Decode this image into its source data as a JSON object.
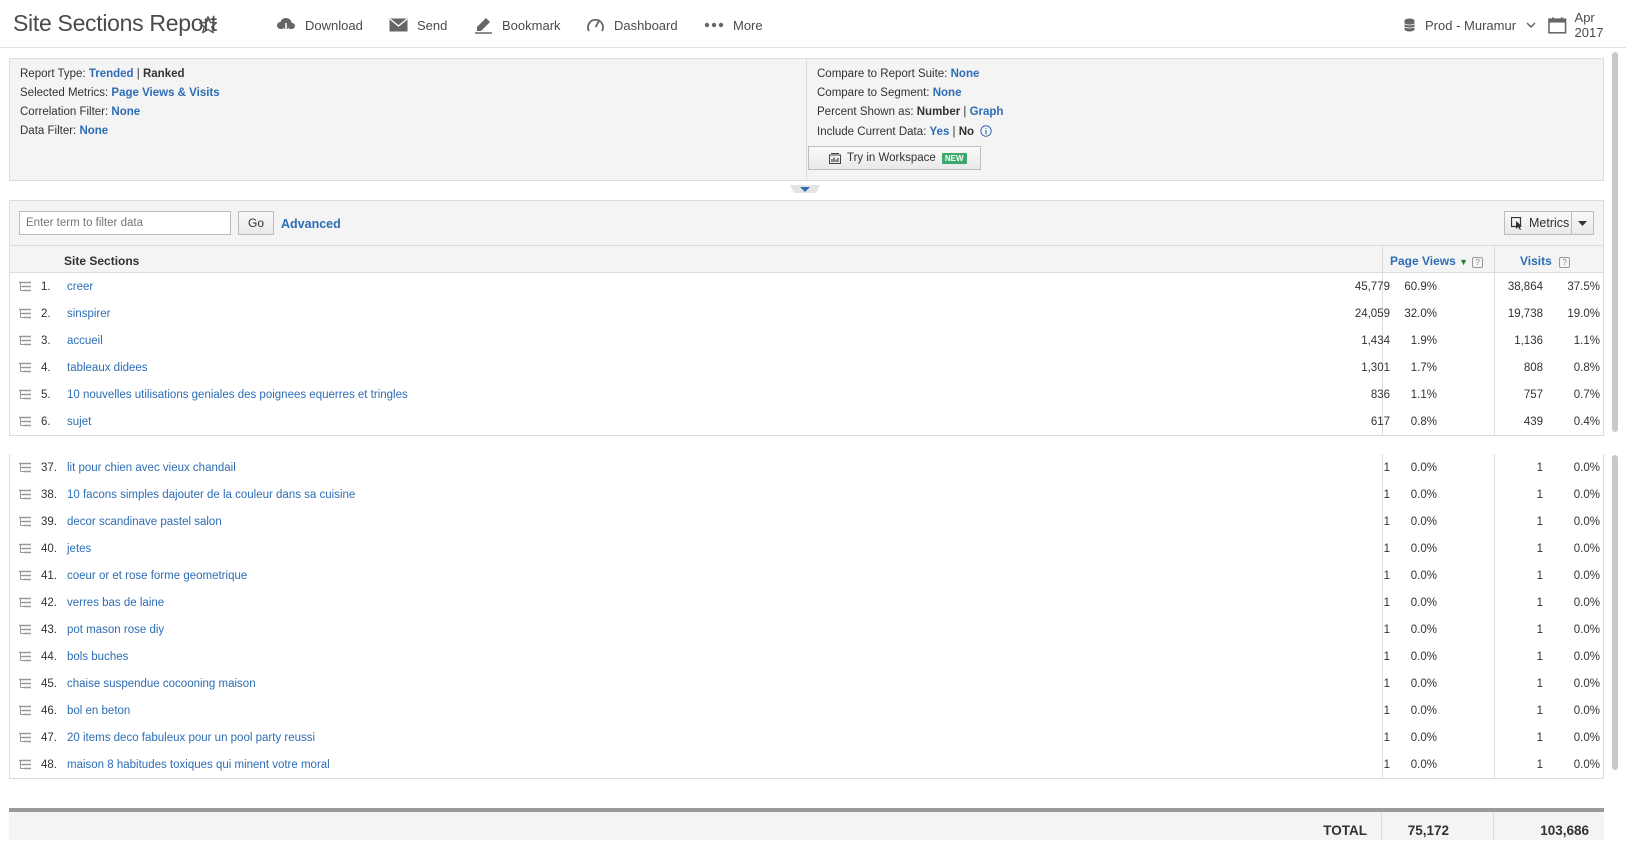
{
  "header": {
    "title": "Site Sections Report",
    "toolbar": [
      {
        "label": "Download",
        "icon": "download-icon"
      },
      {
        "label": "Send",
        "icon": "send-icon"
      },
      {
        "label": "Bookmark",
        "icon": "bookmark-icon"
      },
      {
        "label": "Dashboard",
        "icon": "dashboard-icon"
      },
      {
        "label": "More",
        "icon": "more-icon"
      }
    ],
    "report_suite": "Prod - Muramur",
    "date": "Apr 2017"
  },
  "settings": {
    "report_type_label": "Report Type:",
    "report_type_trended": "Trended",
    "report_type_ranked": "Ranked",
    "metrics_label": "Selected Metrics:",
    "metrics_value": "Page Views & Visits",
    "correlation_label": "Correlation Filter:",
    "correlation_value": "None",
    "data_filter_label": "Data Filter:",
    "data_filter_value": "None",
    "compare_suite_label": "Compare to Report Suite:",
    "compare_suite_value": "None",
    "compare_segment_label": "Compare to Segment:",
    "compare_segment_value": "None",
    "percent_label": "Percent Shown as:",
    "percent_number": "Number",
    "percent_graph": "Graph",
    "current_data_label": "Include Current Data:",
    "current_data_yes": "Yes",
    "current_data_no": "No",
    "workspace_button": "Try in Workspace",
    "new_badge": "NEW"
  },
  "filter": {
    "placeholder": "Enter term to filter data",
    "go_label": "Go",
    "advanced_label": "Advanced",
    "metrics_label": "Metrics"
  },
  "table": {
    "col_name": "Site Sections",
    "col_page_views": "Page Views",
    "col_visits": "Visits",
    "rows_top": [
      {
        "rank": "1.",
        "name": "creer",
        "pv": "45,779",
        "pvp": "60.9%",
        "vi": "38,864",
        "vip": "37.5%"
      },
      {
        "rank": "2.",
        "name": "sinspirer",
        "pv": "24,059",
        "pvp": "32.0%",
        "vi": "19,738",
        "vip": "19.0%"
      },
      {
        "rank": "3.",
        "name": "accueil",
        "pv": "1,434",
        "pvp": "1.9%",
        "vi": "1,136",
        "vip": "1.1%"
      },
      {
        "rank": "4.",
        "name": "tableaux didees",
        "pv": "1,301",
        "pvp": "1.7%",
        "vi": "808",
        "vip": "0.8%"
      },
      {
        "rank": "5.",
        "name": "10 nouvelles utilisations geniales des poignees equerres et tringles",
        "pv": "836",
        "pvp": "1.1%",
        "vi": "757",
        "vip": "0.7%"
      },
      {
        "rank": "6.",
        "name": "sujet",
        "pv": "617",
        "pvp": "0.8%",
        "vi": "439",
        "vip": "0.4%"
      }
    ],
    "rows_bottom": [
      {
        "rank": "37.",
        "name": "lit pour chien avec vieux chandail",
        "pv": "1",
        "pvp": "0.0%",
        "vi": "1",
        "vip": "0.0%"
      },
      {
        "rank": "38.",
        "name": "10 facons simples dajouter de la couleur dans sa cuisine",
        "pv": "1",
        "pvp": "0.0%",
        "vi": "1",
        "vip": "0.0%"
      },
      {
        "rank": "39.",
        "name": "decor scandinave pastel salon",
        "pv": "1",
        "pvp": "0.0%",
        "vi": "1",
        "vip": "0.0%"
      },
      {
        "rank": "40.",
        "name": "jetes",
        "pv": "1",
        "pvp": "0.0%",
        "vi": "1",
        "vip": "0.0%"
      },
      {
        "rank": "41.",
        "name": "coeur or et rose forme geometrique",
        "pv": "1",
        "pvp": "0.0%",
        "vi": "1",
        "vip": "0.0%"
      },
      {
        "rank": "42.",
        "name": "verres bas de laine",
        "pv": "1",
        "pvp": "0.0%",
        "vi": "1",
        "vip": "0.0%"
      },
      {
        "rank": "43.",
        "name": "pot mason rose diy",
        "pv": "1",
        "pvp": "0.0%",
        "vi": "1",
        "vip": "0.0%"
      },
      {
        "rank": "44.",
        "name": "bols buches",
        "pv": "1",
        "pvp": "0.0%",
        "vi": "1",
        "vip": "0.0%"
      },
      {
        "rank": "45.",
        "name": "chaise suspendue cocooning maison",
        "pv": "1",
        "pvp": "0.0%",
        "vi": "1",
        "vip": "0.0%"
      },
      {
        "rank": "46.",
        "name": "bol en beton",
        "pv": "1",
        "pvp": "0.0%",
        "vi": "1",
        "vip": "0.0%"
      },
      {
        "rank": "47.",
        "name": "20 items deco fabuleux pour un pool party reussi",
        "pv": "1",
        "pvp": "0.0%",
        "vi": "1",
        "vip": "0.0%"
      },
      {
        "rank": "48.",
        "name": "maison 8 habitudes toxiques qui minent votre moral",
        "pv": "1",
        "pvp": "0.0%",
        "vi": "1",
        "vip": "0.0%"
      }
    ],
    "total_label": "TOTAL",
    "total_pv": "75,172",
    "total_vi": "103,686"
  }
}
